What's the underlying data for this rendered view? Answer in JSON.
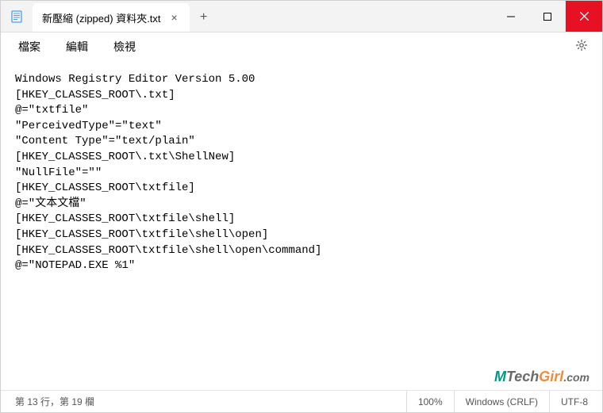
{
  "titlebar": {
    "tab_title": "新壓縮 (zipped) 資料夾.txt",
    "new_tab_label": "+"
  },
  "menu": {
    "file": "檔案",
    "edit": "編輯",
    "view": "檢視"
  },
  "editor": {
    "content": "Windows Registry Editor Version 5.00\n[HKEY_CLASSES_ROOT\\.txt]\n@=\"txtfile\"\n\"PerceivedType\"=\"text\"\n\"Content Type\"=\"text/plain\"\n[HKEY_CLASSES_ROOT\\.txt\\ShellNew]\n\"NullFile\"=\"\"\n[HKEY_CLASSES_ROOT\\txtfile]\n@=\"文本文檔\"\n[HKEY_CLASSES_ROOT\\txtfile\\shell]\n[HKEY_CLASSES_ROOT\\txtfile\\shell\\open]\n[HKEY_CLASSES_ROOT\\txtfile\\shell\\open\\command]\n@=\"NOTEPAD.EXE %1\""
  },
  "status": {
    "cursor": "第 13 行，第 19 欄",
    "zoom": "100%",
    "line_ending": "Windows (CRLF)",
    "encoding": "UTF-8"
  },
  "watermark": {
    "m": "M",
    "tech": "Tech",
    "girl": "Girl",
    "com": ".com"
  }
}
